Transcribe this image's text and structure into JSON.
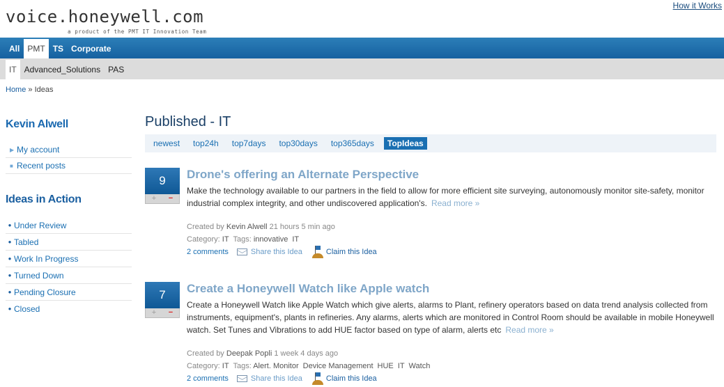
{
  "header": {
    "site_title": "voice.honeywell.com",
    "tagline": "a product of the PMT IT Innovation Team",
    "how_it_works": "How it Works"
  },
  "primary_nav": {
    "tabs": [
      {
        "label": "All",
        "active": false
      },
      {
        "label": "PMT",
        "active": true
      },
      {
        "label": "TS",
        "active": false
      },
      {
        "label": "Corporate",
        "active": false
      }
    ]
  },
  "secondary_nav": {
    "tabs": [
      {
        "label": "IT",
        "active": true
      },
      {
        "label": "Advanced_Solutions",
        "active": false
      },
      {
        "label": "PAS",
        "active": false
      }
    ]
  },
  "breadcrumb": {
    "home": "Home",
    "separator": "»",
    "current": "Ideas"
  },
  "sidebar": {
    "user_name": "Kevin Alwell",
    "account_links": [
      "My account",
      "Recent posts"
    ],
    "ideas_heading": "Ideas in Action",
    "ideas_links": [
      "Under Review",
      "Tabled",
      "Work In Progress",
      "Turned Down",
      "Pending Closure",
      "Closed"
    ]
  },
  "main": {
    "page_title": "Published - IT",
    "sort_tabs": [
      {
        "label": "newest",
        "active": false
      },
      {
        "label": "top24h",
        "active": false
      },
      {
        "label": "top7days",
        "active": false
      },
      {
        "label": "top30days",
        "active": false
      },
      {
        "label": "top365days",
        "active": false
      },
      {
        "label": "TopIdeas",
        "active": true
      }
    ],
    "ideas": [
      {
        "votes": "9",
        "title": "Drone's offering an Alternate Perspective",
        "body": "Make the technology available to our partners in the field to allow for more efficient site surveying, autonomously monitor site-safety, monitor industrial complex integrity, and other undiscovered application's.",
        "read_more": "Read more »",
        "created_by_label": "Created by",
        "author": "Kevin Alwell",
        "age": "21 hours 5 min ago",
        "category_label": "Category:",
        "category": "IT",
        "tags_label": "Tags:",
        "tags": [
          "innovative",
          "IT"
        ],
        "comments": "2 comments",
        "share": "Share this Idea",
        "claim": "Claim this Idea"
      },
      {
        "votes": "7",
        "title": "Create a Honeywell Watch like Apple watch",
        "body": "Create a Honeywell Watch like Apple Watch which give alerts, alarms to Plant, refinery operators based on data trend analysis collected from instruments, equipment's, plants in refineries. Any alarms, alerts which are monitored in Control Room should be available in mobile Honeywell watch. Set Tunes and Vibrations to add HUE factor based on type of alarm, alerts etc",
        "read_more": "Read more »",
        "created_by_label": "Created by",
        "author": "Deepak Popli",
        "age": "1 week 4 days ago",
        "category_label": "Category:",
        "category": "IT",
        "tags_label": "Tags:",
        "tags": [
          "Alert. Monitor",
          "Device Management",
          "HUE",
          "IT",
          "Watch"
        ],
        "comments": "2 comments",
        "share": "Share this Idea",
        "claim": "Claim this Idea"
      }
    ]
  },
  "colors": {
    "nav_blue": "#1661a0",
    "link_blue": "#1a6fb2",
    "title_blue": "#7fa6c8",
    "vote_minus_red": "#d22222"
  },
  "icons": {
    "share": "envelope-icon",
    "claim": "flag-icon",
    "sidebar_account_bullet": "triangle-right-icon",
    "sidebar_ideas_bullet": "dot-icon"
  }
}
